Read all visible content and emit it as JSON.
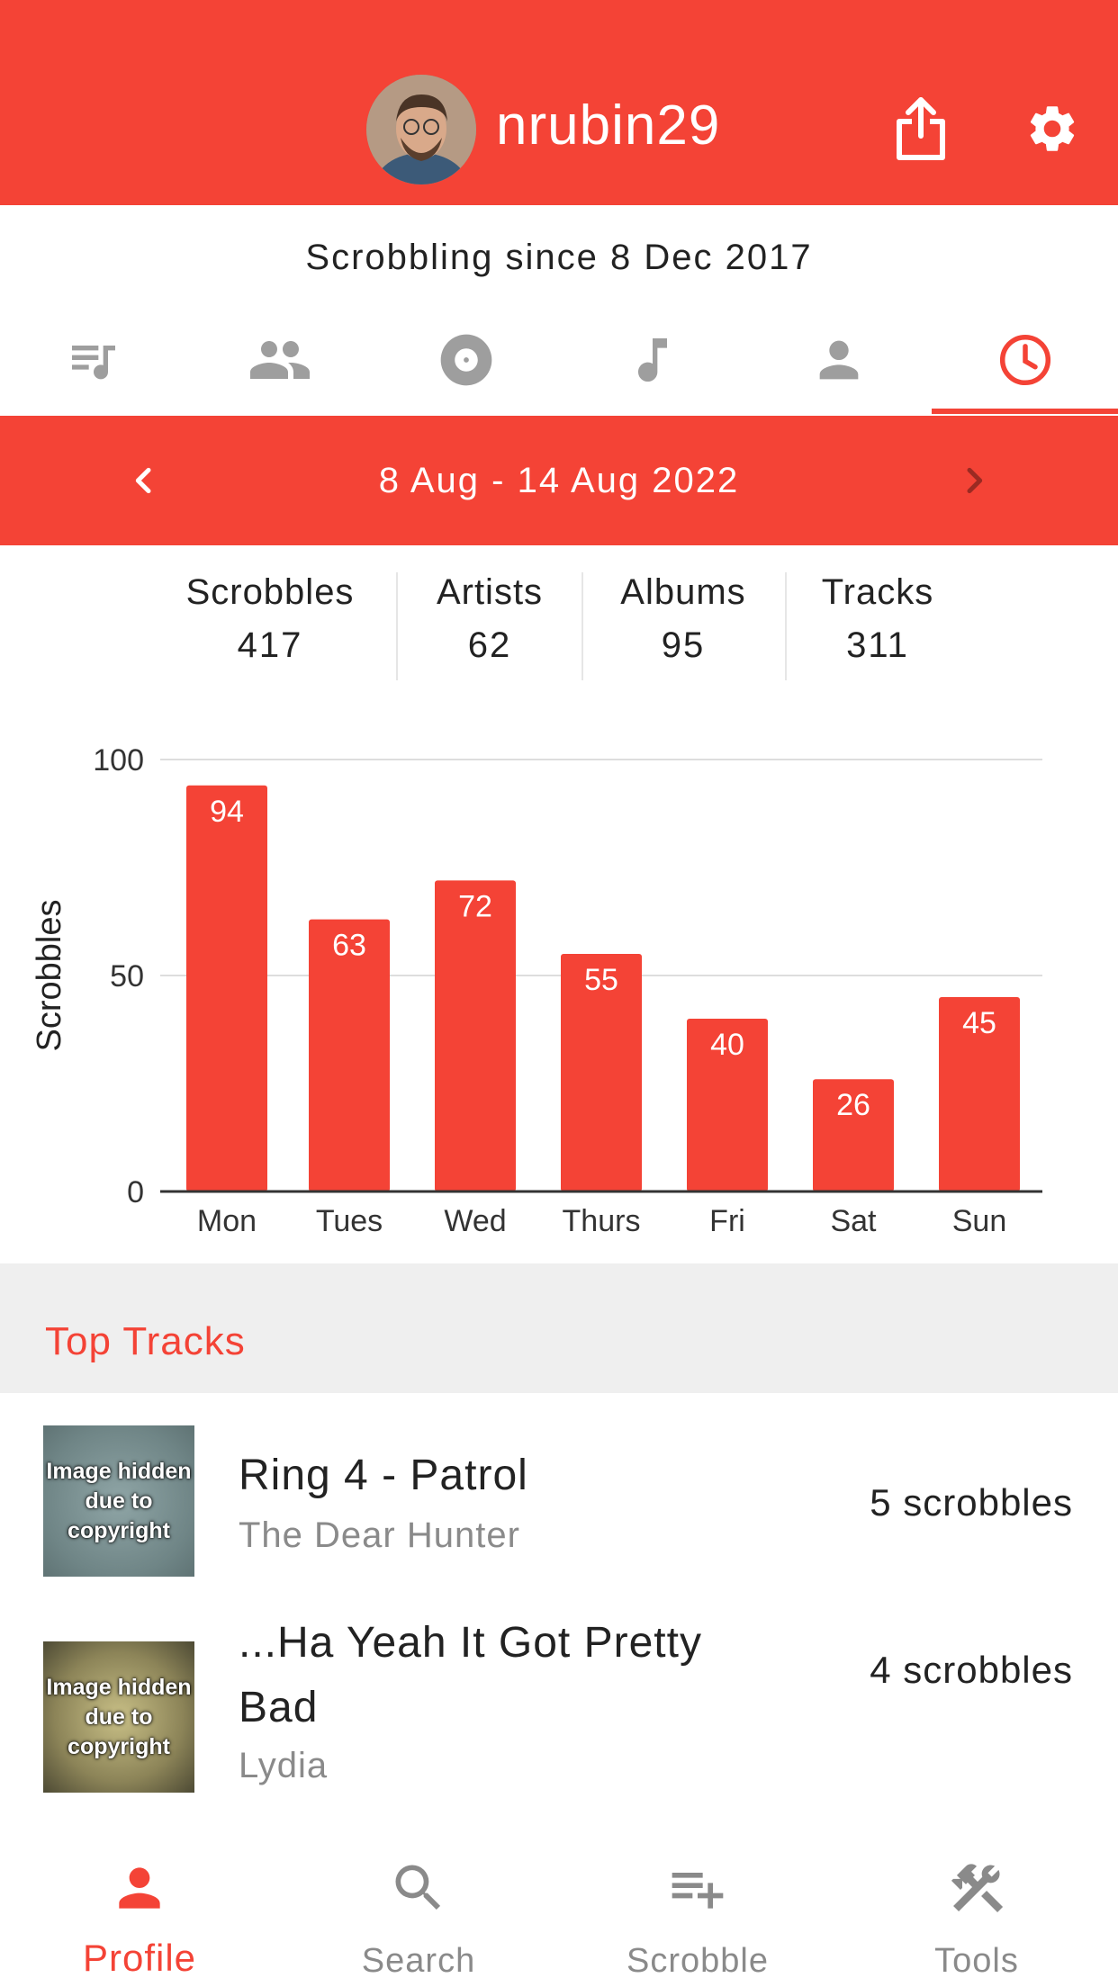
{
  "header": {
    "username": "nrubin29",
    "share_icon": "share-icon",
    "settings_icon": "gear-icon"
  },
  "profile": {
    "since": "Scrobbling since 8 Dec 2017"
  },
  "tabs": [
    {
      "icon": "playlist-icon",
      "active": false
    },
    {
      "icon": "friends-icon",
      "active": false
    },
    {
      "icon": "album-icon",
      "active": false
    },
    {
      "icon": "music-note-icon",
      "active": false
    },
    {
      "icon": "person-icon",
      "active": false
    },
    {
      "icon": "clock-icon",
      "active": true
    }
  ],
  "range": {
    "label": "8 Aug - 14 Aug 2022"
  },
  "stats": [
    {
      "label": "Scrobbles",
      "value": "417"
    },
    {
      "label": "Artists",
      "value": "62"
    },
    {
      "label": "Albums",
      "value": "95"
    },
    {
      "label": "Tracks",
      "value": "311"
    }
  ],
  "chart_data": {
    "type": "bar",
    "categories": [
      "Mon",
      "Tues",
      "Wed",
      "Thurs",
      "Fri",
      "Sat",
      "Sun"
    ],
    "values": [
      94,
      63,
      72,
      55,
      40,
      26,
      45
    ],
    "ylabel": "Scrobbles",
    "yticks": [
      0,
      50,
      100
    ],
    "ylim": [
      0,
      100
    ],
    "grid": true,
    "color": "#f44336"
  },
  "section": {
    "title": "Top Tracks"
  },
  "tracks": [
    {
      "title": "Ring 4 - Patrol",
      "artist": "The Dear Hunter",
      "count": "5 scrobbles",
      "art_text": "Image hidden due to copyright"
    },
    {
      "title": "...Ha Yeah It Got Pretty Bad",
      "artist": "Lydia",
      "count": "4 scrobbles",
      "art_text": "Image hidden due to copyright"
    }
  ],
  "nav": [
    {
      "label": "Profile",
      "icon": "person-icon",
      "active": true
    },
    {
      "label": "Search",
      "icon": "search-icon",
      "active": false
    },
    {
      "label": "Scrobble",
      "icon": "playlist-add-icon",
      "active": false
    },
    {
      "label": "Tools",
      "icon": "tools-icon",
      "active": false
    }
  ],
  "colors": {
    "accent": "#f44336",
    "inactive_icon": "#9e9e9e",
    "section_bg": "#efefef"
  }
}
